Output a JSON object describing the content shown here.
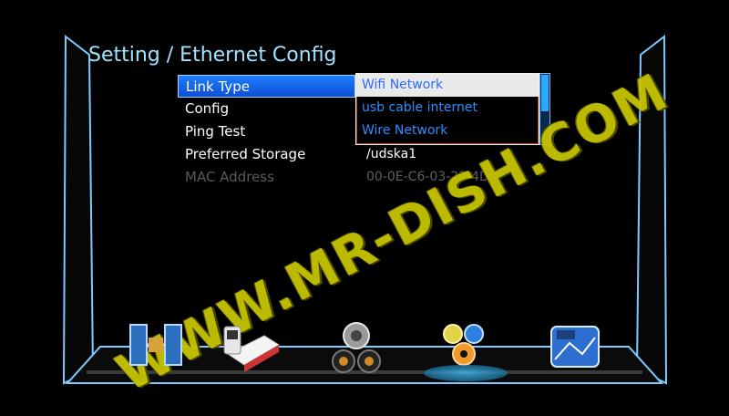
{
  "header": {
    "title": "Setting / Ethernet Config"
  },
  "menu": {
    "items": [
      {
        "label": "Link Type",
        "value": "Wifi Network",
        "state": "selected"
      },
      {
        "label": "Config",
        "value": "usb cable internet",
        "state": "normal"
      },
      {
        "label": "Ping Test",
        "value": "Wire Network",
        "state": "normal"
      },
      {
        "label": "Preferred Storage",
        "value": "/udska1",
        "state": "normal"
      },
      {
        "label": "MAC Address",
        "value": "00-0E-C6-03-23-4D",
        "state": "disabled"
      }
    ]
  },
  "dropdown": {
    "options": [
      {
        "label": "Wifi Network",
        "selected": true
      },
      {
        "label": "usb cable internet",
        "selected": false
      },
      {
        "label": "Wire Network",
        "selected": false
      }
    ]
  },
  "watermark": {
    "text": "WWW.MR-DISH.COM"
  },
  "icons": [
    {
      "name": "satellite-icon"
    },
    {
      "name": "media-player-icon"
    },
    {
      "name": "settings-gears-binoculars-icon"
    },
    {
      "name": "system-settings-gears-icon"
    },
    {
      "name": "media-gallery-icon"
    }
  ],
  "colors": {
    "accent": "#2aa7ff",
    "watermark": "#c7c400"
  }
}
